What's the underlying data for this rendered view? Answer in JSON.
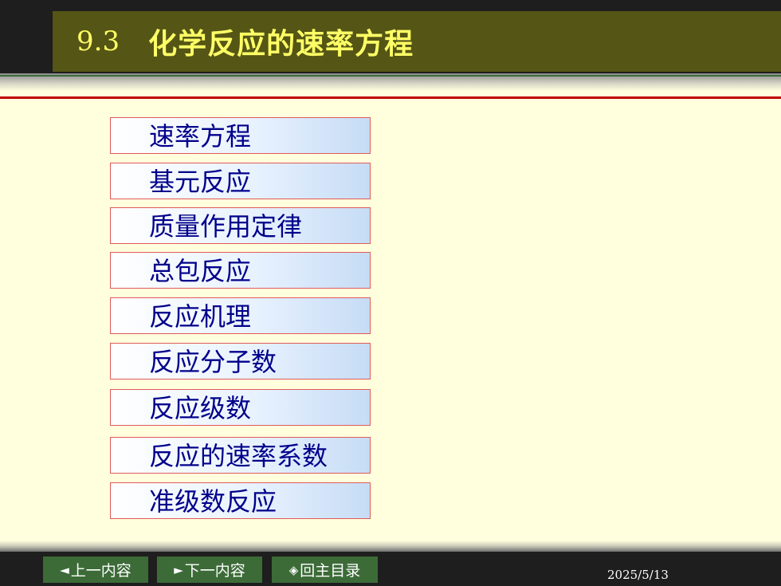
{
  "header": {
    "section_number": "9.3",
    "title": "化学反应的速率方程"
  },
  "topics": [
    {
      "label": "速率方程"
    },
    {
      "label": "基元反应"
    },
    {
      "label": "质量作用定律"
    },
    {
      "label": "总包反应"
    },
    {
      "label": "反应机理"
    },
    {
      "label": "反应分子数"
    },
    {
      "label": "反应级数"
    },
    {
      "label": "反应的速率系数"
    },
    {
      "label": "准级数反应"
    }
  ],
  "footer": {
    "prev": {
      "icon": "◄",
      "label": "上一内容"
    },
    "next": {
      "icon": "►",
      "label": "下一内容"
    },
    "home": {
      "icon": "◈",
      "label": "回主目录"
    },
    "date": "2025/5/13"
  },
  "colors": {
    "title_text": "#ffff66",
    "title_bg": "#555515",
    "page_bg": "#ffffdd",
    "topic_text": "#00008b",
    "topic_border": "#e05a5a",
    "rule": "#c00000",
    "nav_button": "#3c6b38"
  }
}
